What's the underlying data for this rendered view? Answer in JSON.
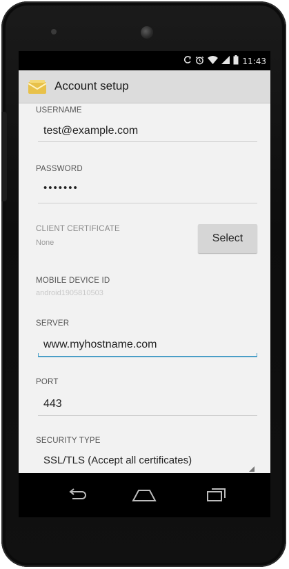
{
  "status_bar": {
    "time": "11:43",
    "icons": [
      "sync-icon",
      "alarm-icon",
      "wifi-icon",
      "signal-icon",
      "battery-icon"
    ]
  },
  "action_bar": {
    "title": "Account setup",
    "icon": "email-app-icon"
  },
  "form": {
    "username": {
      "label": "USERNAME",
      "value": "test@example.com"
    },
    "password": {
      "label": "PASSWORD",
      "value": "•••••••"
    },
    "client_certificate": {
      "label": "CLIENT CERTIFICATE",
      "value": "None",
      "button_label": "Select"
    },
    "mobile_device_id": {
      "label": "MOBILE DEVICE ID",
      "value": "android1905810503"
    },
    "server": {
      "label": "SERVER",
      "value": "www.myhostname.com"
    },
    "port": {
      "label": "PORT",
      "value": "443"
    },
    "security_type": {
      "label": "SECURITY TYPE",
      "value": "SSL/TLS (Accept all certificates)"
    }
  },
  "navigation": {
    "back": "back-icon",
    "home": "home-icon",
    "recents": "recents-icon"
  },
  "colors": {
    "focus_accent": "#4a9ec7",
    "action_bar_bg": "#dcdcdc",
    "content_bg": "#f2f2f2"
  }
}
